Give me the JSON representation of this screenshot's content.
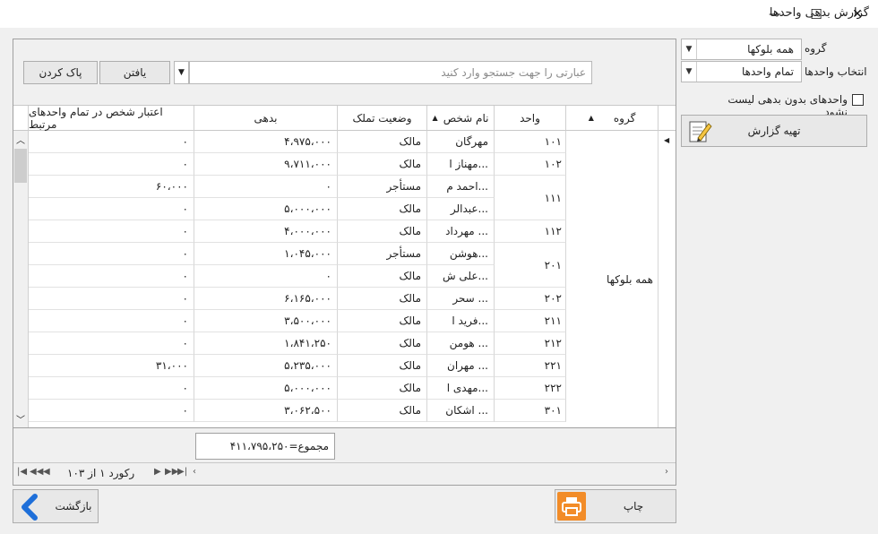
{
  "window": {
    "title": "گزارش بدهی واحدها",
    "minimize": "—",
    "maximize": "☐",
    "close": "✕"
  },
  "filters": {
    "group_label": "گروه",
    "group_value": "همه بلوکها",
    "units_label": "انتخاب واحدها",
    "units_value": "تمام واحدها",
    "no_debt_checkbox_label": "واحدهای بدون بدهی لیست نشود",
    "no_debt_checked": false,
    "prepare_report_label": "تهیه گزارش"
  },
  "search": {
    "placeholder": "عبارتی را جهت جستجو وارد کنید",
    "value": "",
    "find_label": "یافتن",
    "clear_label": "پاک کردن"
  },
  "grid": {
    "columns": {
      "group": "گروه",
      "unit": "واحد",
      "person": "نام شخص",
      "ownership": "وضعیت تملک",
      "debt": "بدهی",
      "credit": "اعتبار شخص در تمام واحدهای مرتبط"
    },
    "group_cell": "همه بلوکها",
    "unit_cells": [
      "۱۰۱",
      "۱۰۲",
      "۱۱۱",
      "۱۱۲",
      "۲۰۱",
      "۲۰۲",
      "۲۱۱",
      "۲۱۲",
      "۲۲۱",
      "۲۲۲",
      "۳۰۱"
    ],
    "rows": [
      {
        "person": "مهرگان",
        "ownership": "مالک",
        "debt": "۴،۹۷۵،۰۰۰",
        "credit": "۰"
      },
      {
        "person": "مهناز ا...",
        "ownership": "مالک",
        "debt": "۹،۷۱۱،۰۰۰",
        "credit": "۰"
      },
      {
        "person": "احمد م...",
        "ownership": "مستأجر",
        "debt": "۰",
        "credit": "۶۰،۰۰۰"
      },
      {
        "person": "عبدالر...",
        "ownership": "مالک",
        "debt": "۵،۰۰۰،۰۰۰",
        "credit": "۰"
      },
      {
        "person": "مهرداد ...",
        "ownership": "مالک",
        "debt": "۴،۰۰۰،۰۰۰",
        "credit": "۰"
      },
      {
        "person": "هوشن...",
        "ownership": "مستأجر",
        "debt": "۱،۰۴۵،۰۰۰",
        "credit": "۰"
      },
      {
        "person": "علی ش...",
        "ownership": "مالک",
        "debt": "۰",
        "credit": "۰"
      },
      {
        "person": "سحر ...",
        "ownership": "مالک",
        "debt": "۶،۱۶۵،۰۰۰",
        "credit": "۰"
      },
      {
        "person": "فرید ا...",
        "ownership": "مالک",
        "debt": "۳،۵۰۰،۰۰۰",
        "credit": "۰"
      },
      {
        "person": "هومن ...",
        "ownership": "مالک",
        "debt": "۱،۸۴۱،۲۵۰",
        "credit": "۰"
      },
      {
        "person": "مهران ...",
        "ownership": "مالک",
        "debt": "۵،۲۳۵،۰۰۰",
        "credit": "۳۱،۰۰۰"
      },
      {
        "person": "مهدی ا...",
        "ownership": "مالک",
        "debt": "۵،۰۰۰،۰۰۰",
        "credit": "۰"
      },
      {
        "person": "اشکان ...",
        "ownership": "مالک",
        "debt": "۳،۰۶۲،۵۰۰",
        "credit": "۰"
      }
    ],
    "total": "مجموع=۴۱۱،۷۹۵،۲۵۰",
    "record_nav": "رکورد ۱ از ۱۰۳"
  },
  "buttons": {
    "print_label": "چاپ",
    "back_label": "بازگشت"
  },
  "colors": {
    "print_icon_bg": "#f28c28",
    "back_arrow": "#1e6fd9"
  }
}
